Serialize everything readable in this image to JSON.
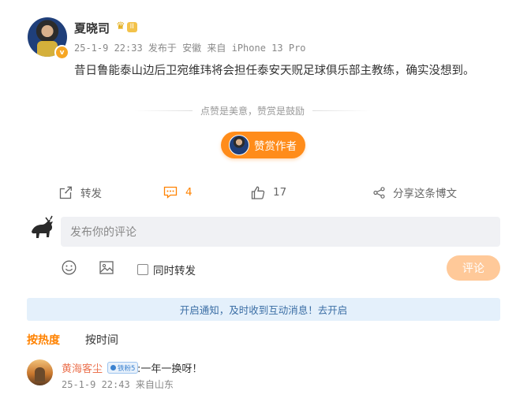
{
  "post": {
    "author": "夏晓司",
    "level_badge": "II",
    "meta": "25-1-9 22:33 发布于 安徽 来自 iPhone 13 Pro",
    "content": "昔日鲁能泰山边后卫宛维玮将会担任泰安天贶足球俱乐部主教练，确实没想到。"
  },
  "reward": {
    "hint": "点赞是美意，赞赏是鼓励",
    "button_label": "赞赏作者"
  },
  "actions": {
    "forward_label": "转发",
    "comment_count": "4",
    "like_count": "17",
    "share_label": "分享这条博文"
  },
  "composer": {
    "placeholder": "发布你的评论",
    "repost_label": "同时转发",
    "submit_label": "评论"
  },
  "notice": {
    "text": "开启通知，及时收到互动消息！去开启"
  },
  "sort": {
    "hot_label": "按热度",
    "time_label": "按时间"
  },
  "comments": [
    {
      "name": "黄海客尘",
      "badge": "铁粉5",
      "text": ":一年一换呀！",
      "meta": "25-1-9 22:43 来自山东"
    }
  ],
  "colors": {
    "accent_orange": "#ff8200",
    "reward_button": "#ff8c1a",
    "submit_disabled": "#ffc999",
    "notice_bg": "#e4f0fb",
    "commenter_name": "#eb7350"
  }
}
